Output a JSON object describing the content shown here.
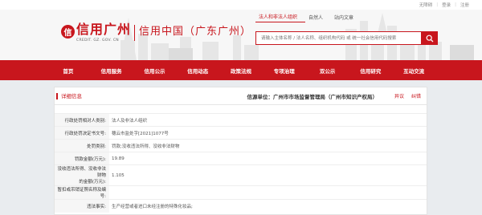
{
  "topbar": {
    "status": "您好：无障碍",
    "links": [
      "无障碍",
      "登录",
      "注册"
    ]
  },
  "brand": {
    "logo_mark": "信",
    "logo_cn": "信用广州",
    "logo_en": "CREDIT. GZ. GOV. CN",
    "site_title": "信用中国（广东广州）"
  },
  "search": {
    "tabs": [
      "法人和非法人组织",
      "自然人",
      "站内文章"
    ],
    "active_tab": 0,
    "placeholder": "请输入主体名称 / 法人名称、组织机构代码 或 统一社会信用代码搜索"
  },
  "nav": [
    "首页",
    "信用服务",
    "信用公示",
    "信用动态",
    "政策法规",
    "专项治理",
    "双公示",
    "信用研究",
    "互动交流"
  ],
  "detail": {
    "title": "详细信息",
    "source": "信源单位：广州市市场监督管理局（广州市知识产权局）",
    "links": [
      "异议",
      "纠错"
    ],
    "rows": [
      {
        "label": "行政处罚相对人类别:",
        "value": "法人及非法人组织"
      },
      {
        "label": "行政处罚决定书文号:",
        "value": "穗云市监处字[2021]1077号"
      },
      {
        "label": "处罚类别:",
        "value": "罚款;没收违法所得、没收非法财物"
      },
      {
        "label": "罚款金额(万元):",
        "value": "19.89"
      },
      {
        "label": "没收违法所得、没收非法财物的金额(万元):",
        "label_line1": "没收违法所得、没收非法财物",
        "label_line2": "的金额(万元):",
        "value": "1.105"
      },
      {
        "label": "暂扣或吊销证照名称及编号:",
        "value": ""
      },
      {
        "label": "违法事实:",
        "value": "生产经营或者进口未经注册的特殊化妆品;"
      }
    ]
  },
  "colors": {
    "brand_red": "#c8161d",
    "page_bg": "#e9ecef"
  }
}
